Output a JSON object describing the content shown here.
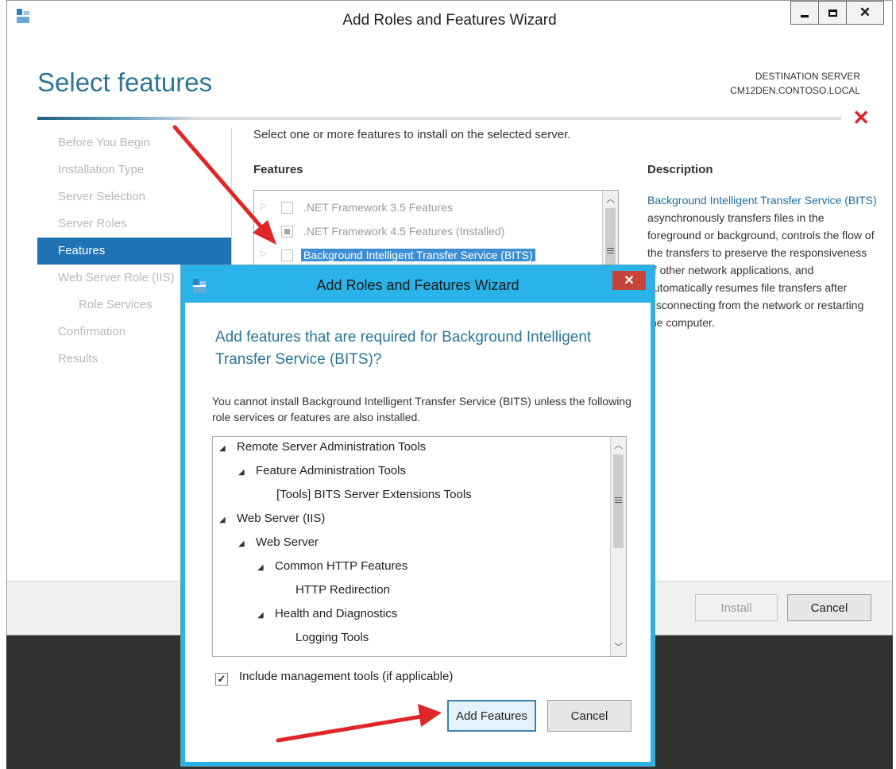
{
  "main_window": {
    "title": "Add Roles and Features Wizard",
    "page_title": "Select features",
    "destination_label": "DESTINATION SERVER",
    "destination_server": "CM12DEN.CONTOSO.LOCAL",
    "nav": [
      {
        "label": "Before You Begin",
        "active": false
      },
      {
        "label": "Installation Type",
        "active": false
      },
      {
        "label": "Server Selection",
        "active": false
      },
      {
        "label": "Server Roles",
        "active": false
      },
      {
        "label": "Features",
        "active": true
      },
      {
        "label": "Web Server Role (IIS)",
        "active": false
      },
      {
        "label": "Role Services",
        "active": false,
        "sub": true
      },
      {
        "label": "Confirmation",
        "active": false
      },
      {
        "label": "Results",
        "active": false
      }
    ],
    "instruction": "Select one or more features to install on the selected server.",
    "features_label": "Features",
    "features": [
      {
        "label": ".NET Framework 3.5 Features",
        "state": "unchecked"
      },
      {
        "label": ".NET Framework 4.5 Features (Installed)",
        "state": "indeterminate"
      },
      {
        "label": "Background Intelligent Transfer Service (BITS)",
        "state": "unchecked",
        "selected": true
      }
    ],
    "description_label": "Description",
    "description_link": "Background Intelligent Transfer Service (BITS)",
    "description_text": " asynchronously transfers files in the foreground or background, controls the flow of the transfers to preserve the responsiveness of other network applications, and automatically resumes file transfers after disconnecting from the network or restarting the computer.",
    "install_button": "Install",
    "cancel_button": "Cancel"
  },
  "dialog": {
    "title": "Add Roles and Features Wizard",
    "heading": "Add features that are required for Background Intelligent Transfer Service (BITS)?",
    "message": "You cannot install Background Intelligent Transfer Service (BITS) unless the following role services or features are also installed.",
    "required": [
      {
        "label": "Remote Server Administration Tools",
        "level": 0,
        "expandable": true
      },
      {
        "label": "Feature Administration Tools",
        "level": 1,
        "expandable": true
      },
      {
        "label": "[Tools] BITS Server Extensions Tools",
        "level": 2,
        "expandable": false
      },
      {
        "label": "Web Server (IIS)",
        "level": 0,
        "expandable": true
      },
      {
        "label": "Web Server",
        "level": 1,
        "expandable": true
      },
      {
        "label": "Common HTTP Features",
        "level": 2,
        "expandable": true
      },
      {
        "label": "HTTP Redirection",
        "level": 3,
        "expandable": false
      },
      {
        "label": "Health and Diagnostics",
        "level": 2,
        "expandable": true
      },
      {
        "label": "Logging Tools",
        "level": 3,
        "expandable": false
      }
    ],
    "include_mgmt_label": "Include management tools (if applicable)",
    "include_mgmt_checked": true,
    "add_features_button": "Add Features",
    "cancel_button": "Cancel"
  }
}
